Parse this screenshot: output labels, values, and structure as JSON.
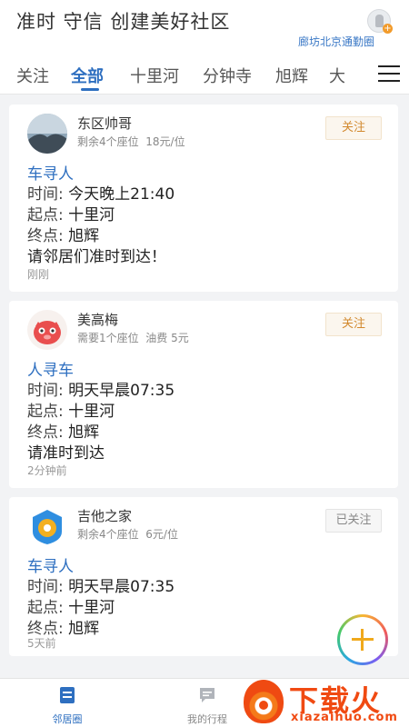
{
  "header": {
    "slogan": "准时 守信 创建美好社区",
    "circle_name": "廊坊北京通勤圈",
    "avatar_icon": "user-add-icon"
  },
  "tabs": {
    "items": [
      "关注",
      "全部",
      "十里河",
      "分钟寺",
      "旭辉",
      "大"
    ],
    "active": "全部",
    "menu_icon": "hamburger-menu-icon"
  },
  "colors": {
    "accent": "#2e6fc0",
    "follow": "#d2892e",
    "fab": "#f0a91c",
    "watermark": "#f04a12"
  },
  "posts": [
    {
      "name": "东区帅哥",
      "seats": "剩余4个座位",
      "price": "18元/位",
      "button": "关注",
      "type": "车寻人",
      "time_label": "时间:",
      "time": "今天晚上21:40",
      "start_label": "起点:",
      "start": "十里河",
      "end_label": "终点:",
      "end": "旭辉",
      "note": "请邻居们准时到达！",
      "ago": "刚刚"
    },
    {
      "name": "美高梅",
      "seats": "需要1个座位",
      "price": "油费 5元",
      "button": "关注",
      "type": "人寻车",
      "time_label": "时间:",
      "time": "明天早晨07:35",
      "start_label": "起点:",
      "start": "十里河",
      "end_label": "终点:",
      "end": "旭辉",
      "note": "请准时到达",
      "ago": "2分钟前"
    },
    {
      "name": "吉他之家",
      "seats": "剩余4个座位",
      "price": "6元/位",
      "button": "已关注",
      "type": "车寻人",
      "time_label": "时间:",
      "time": "明天早晨07:35",
      "start_label": "起点:",
      "start": "十里河",
      "end_label": "终点:",
      "end": "旭辉",
      "ago": "5天前"
    }
  ],
  "fab_icon": "add-icon",
  "bottom_nav": {
    "items": [
      {
        "label": "邻居圈",
        "icon": "notebook-icon"
      },
      {
        "label": "我的行程",
        "icon": "chat-icon"
      }
    ],
    "active": "邻居圈"
  },
  "watermark": {
    "big": "下载火",
    "small": "xiazaihuo.com"
  }
}
